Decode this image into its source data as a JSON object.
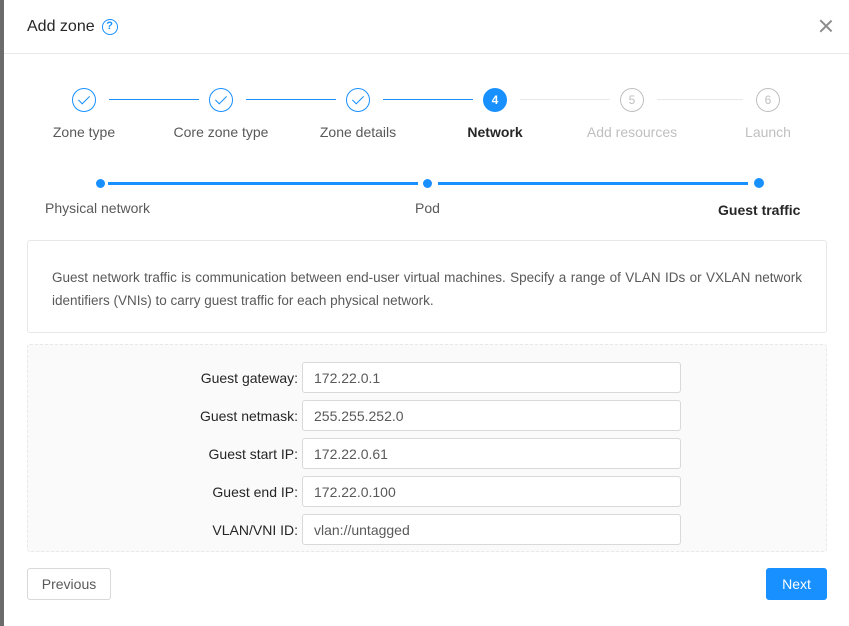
{
  "modal": {
    "title": "Add zone",
    "help_icon": "question-circle-icon",
    "close_icon": "close-icon"
  },
  "steps": [
    {
      "number": "1",
      "label": "Zone type",
      "status": "done"
    },
    {
      "number": "2",
      "label": "Core zone type",
      "status": "done"
    },
    {
      "number": "3",
      "label": "Zone details",
      "status": "done"
    },
    {
      "number": "4",
      "label": "Network",
      "status": "active"
    },
    {
      "number": "5",
      "label": "Add resources",
      "status": "wait"
    },
    {
      "number": "6",
      "label": "Launch",
      "status": "wait"
    }
  ],
  "substeps": [
    {
      "label": "Physical network",
      "status": "done"
    },
    {
      "label": "Pod",
      "status": "done"
    },
    {
      "label": "Guest traffic",
      "status": "active"
    }
  ],
  "info": {
    "text": "Guest network traffic is communication between end-user virtual machines. Specify a range of VLAN IDs or VXLAN network identifiers (VNIs) to carry guest traffic for each physical network."
  },
  "form": {
    "fields": [
      {
        "label": "Guest gateway",
        "value": "172.22.0.1"
      },
      {
        "label": "Guest netmask",
        "value": "255.255.252.0"
      },
      {
        "label": "Guest start IP",
        "value": "172.22.0.61"
      },
      {
        "label": "Guest end IP",
        "value": "172.22.0.100"
      },
      {
        "label": "VLAN/VNI ID",
        "value": "vlan://untagged"
      }
    ]
  },
  "footer": {
    "previous_label": "Previous",
    "next_label": "Next"
  },
  "colors": {
    "primary": "#1890ff",
    "border": "#d9d9d9",
    "inactive": "#bfbfbf"
  }
}
